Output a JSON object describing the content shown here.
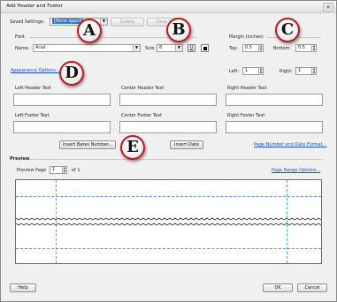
{
  "window": {
    "title": "Add Header and Footer",
    "close_glyph": "×"
  },
  "settings": {
    "label": "Saved Settings:",
    "value": "[None specif",
    "delete_label": "Delete",
    "save_label": "Save S"
  },
  "font": {
    "group_label": "Font",
    "name_label": "Name:",
    "name_value": "Arial",
    "size_label": "Size:",
    "size_value": "8",
    "underline_label": "U"
  },
  "margin": {
    "group_label": "Margin (inches)",
    "top_label": "Top:",
    "top_value": "0.5",
    "bottom_label": "Bottom:",
    "bottom_value": "0.5",
    "left_label": "Left:",
    "left_value": "1",
    "right_label": "Right:",
    "right_value": "1"
  },
  "appearance_link": "Appearance Options...",
  "header": {
    "left": "Left Header Text",
    "center": "Center Header Text",
    "right": "Right Header Text"
  },
  "footer": {
    "left": "Left Footer Text",
    "center": "Center Footer Text",
    "right": "Right Footer Text"
  },
  "buttons": {
    "bates": "Insert Bates Number...",
    "date": "Insert Date",
    "page_date_format": "Page Number and Date Format...",
    "help": "Help",
    "ok": "OK",
    "cancel": "Cancel"
  },
  "preview": {
    "group_label": "Preview",
    "page_label": "Preview Page",
    "page_value": "1",
    "of_label": "of 1",
    "range_link": "Page Range Options..."
  },
  "callouts": [
    "A",
    "B",
    "C",
    "D",
    "E"
  ],
  "colors": {
    "callout_border": "#c0161b",
    "link": "#1a4fc4",
    "selection": "#3173d6",
    "guides": "#5a9be0"
  }
}
